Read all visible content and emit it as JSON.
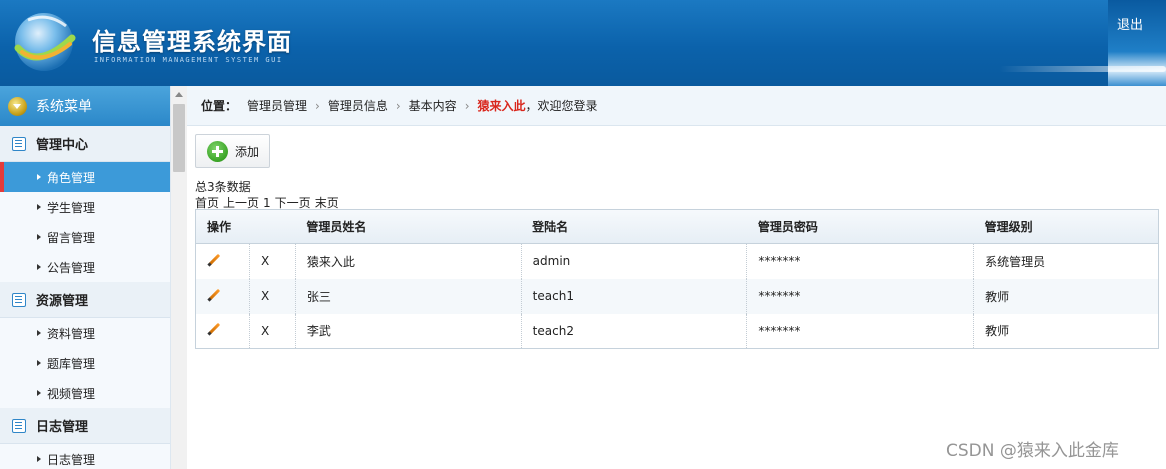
{
  "header": {
    "title": "信息管理系统界面",
    "subtitle": "INFORMATION MANAGEMENT SYSTEM GUI",
    "logout_label": "退出"
  },
  "sidebar": {
    "menu_title": "系统菜单",
    "groups": [
      {
        "label": "管理中心",
        "items": [
          "角色管理",
          "学生管理",
          "留言管理",
          "公告管理"
        ]
      },
      {
        "label": "资源管理",
        "items": [
          "资料管理",
          "题库管理",
          "视频管理"
        ]
      },
      {
        "label": "日志管理",
        "items": [
          "日志管理"
        ]
      }
    ],
    "active_item": "角色管理"
  },
  "breadcrumb": {
    "prefix": "位置：",
    "items": [
      "管理员管理",
      "管理员信息",
      "基本内容"
    ],
    "user": "猿来入此",
    "welcome": "，欢迎您登录"
  },
  "toolbar": {
    "add_label": "添加"
  },
  "summary": {
    "total": "总3条数据"
  },
  "pager": {
    "first": "首页",
    "prev": "上一页",
    "current": "1",
    "next": "下一页",
    "last": "末页"
  },
  "table": {
    "headers": [
      "操作",
      "",
      "管理员姓名",
      "登陆名",
      "管理员密码",
      "管理级别"
    ],
    "delete_label": "X",
    "rows": [
      {
        "name": "猿来入此",
        "login": "admin",
        "password": "*******",
        "level": "系统管理员"
      },
      {
        "name": "张三",
        "login": "teach1",
        "password": "*******",
        "level": "教师"
      },
      {
        "name": "李武",
        "login": "teach2",
        "password": "*******",
        "level": "教师"
      }
    ]
  },
  "watermark": "CSDN @猿来入此金库",
  "colors": {
    "header": "#0b62ab",
    "active": "#3c9ad9",
    "highlight": "#d9261c"
  }
}
